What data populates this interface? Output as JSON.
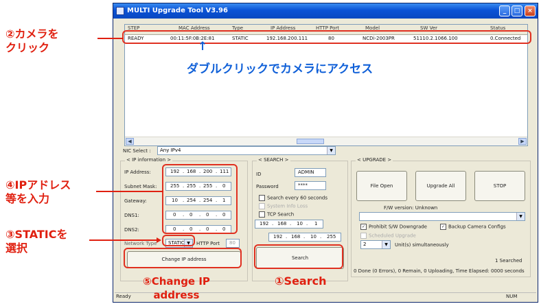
{
  "window": {
    "title": "MULTI Upgrade Tool V3.96"
  },
  "list": {
    "headers": [
      "STEP",
      "MAC Address",
      "Type",
      "IP Address",
      "HTTP Port",
      "Model",
      "SW Ver",
      "Status"
    ],
    "row": [
      "READY",
      "00:11:5F:0B:2E:81",
      "STATIC",
      "192.168.200.111",
      "80",
      "NCDi-2003PR",
      "51110.2.1066.100",
      "0.Connected"
    ]
  },
  "nic": {
    "label": "NIC Select :",
    "value": "Any IPv4"
  },
  "ipinfo": {
    "title": "< IP information >",
    "ip_label": "IP Address:",
    "ip": [
      "192",
      "168",
      "200",
      "111"
    ],
    "mask_label": "Subnet Mask:",
    "mask": [
      "255",
      "255",
      "255",
      "0"
    ],
    "gw_label": "Gateway:",
    "gw": [
      "10",
      "254",
      "254",
      "1"
    ],
    "dns1_label": "DNS1:",
    "dns1": [
      "0",
      "0",
      "0",
      "0"
    ],
    "dns2_label": "DNS2:",
    "dns2": [
      "0",
      "0",
      "0",
      "0"
    ],
    "network_type_label": "Network Type",
    "network_type": "STATIC",
    "http_port_label": "HTTP Port",
    "http_port": "80",
    "change_button": "Change IP address"
  },
  "search": {
    "title": "< SEARCH >",
    "id_label": "ID",
    "id_value": "ADMIN",
    "pw_label": "Password",
    "pw_value": "****",
    "every60": "Search every 60 seconds",
    "sysinfo": "System Info Loss",
    "tcp": "TCP Search",
    "ip_a": [
      "192",
      "168",
      "10",
      "1"
    ],
    "ip_b": [
      "192",
      "168",
      "10",
      "255"
    ],
    "button": "Search"
  },
  "upgrade": {
    "title": "< UPGRADE >",
    "file_open": "File Open",
    "upgrade_all": "Upgrade All",
    "stop": "STOP",
    "fw_version": "F/W version: Unknown",
    "prohibit": "Prohibit S/W Downgrade",
    "backup": "Backup Camera Configs",
    "scheduled": "Scheduled Upgrade",
    "units_value": "2",
    "units_label": "Unit(s) simultaneously",
    "searched": "1 Searched",
    "summary": "0 Done (0 Errors), 0 Remain, 0 Uploading, Time Elapsed: 0000 seconds"
  },
  "statusbar": {
    "left": "Ready",
    "right": "NUM"
  },
  "annotations": {
    "click_camera": "②カメラを\nクリック",
    "double_click": "ダブルクリックでカメラにアクセス",
    "ip_address": "④IPアドレス\n等を入力",
    "static": "③STATICを\n選択",
    "change_ip": "⑤Change IP\naddress",
    "search": "①Search",
    "arrow_up": "↑"
  },
  "colors": {
    "annotation_red": "#e02010",
    "annotation_blue": "#1060d8",
    "title_blue": "#0a52d6"
  }
}
